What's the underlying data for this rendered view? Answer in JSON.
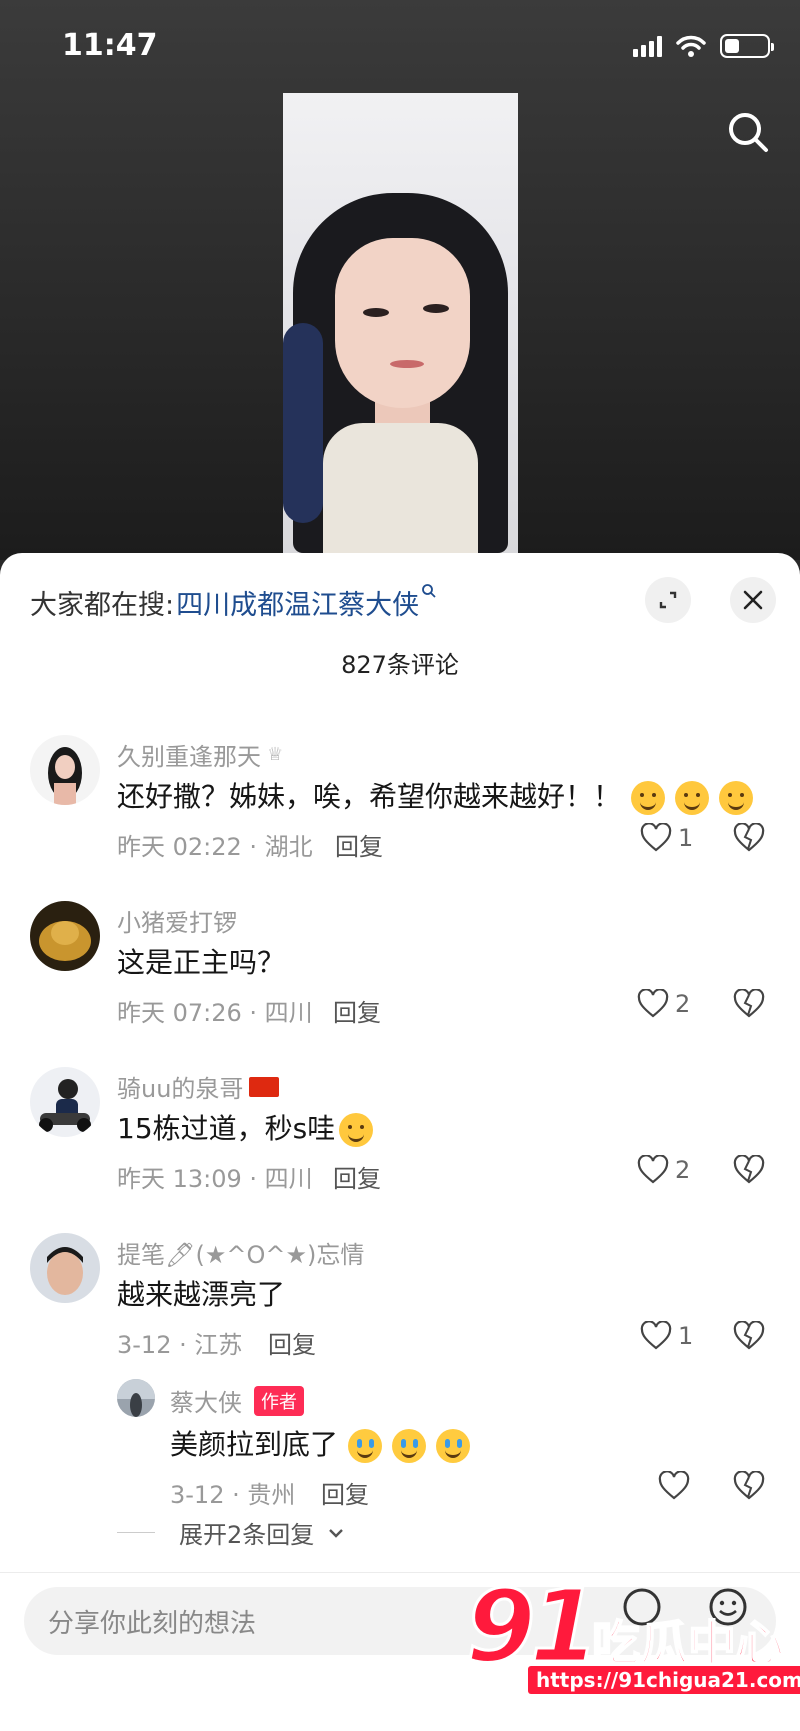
{
  "status_bar": {
    "time": "11:47"
  },
  "sheet": {
    "trend_prefix": "大家都在搜:",
    "trend_link": "四川成都温江蔡大侠",
    "comment_count": "827条评论"
  },
  "comments": [
    {
      "name": "久别重逢那天",
      "name_badge": "♕",
      "text": "还好撒？姊妹，唉，希望你越来越好！！",
      "time_loc": "昨天 02:22 · 湖北",
      "reply": "回复",
      "likes": "1"
    },
    {
      "name": "小猪爱打锣",
      "text": "这是正主吗？",
      "time_loc": "昨天 07:26 · 四川",
      "reply": "回复",
      "likes": "2"
    },
    {
      "name": "骑uu的泉哥",
      "name_badge": "🇨🇳",
      "text": "15栋过道，秒s哇",
      "time_loc": "昨天 13:09 · 四川",
      "reply": "回复",
      "likes": "2"
    },
    {
      "name": "提笔🖊(★^O^★)忘情",
      "text": "越来越漂亮了",
      "time_loc": "3-12 · 江苏",
      "reply": "回复",
      "likes": "1"
    }
  ],
  "sub_reply": {
    "name": "蔡大侠",
    "badge": "作者",
    "text": "美颜拉到底了",
    "time_loc": "3-12 · 贵州",
    "reply": "回复"
  },
  "expand_more": "展开2条回复",
  "input": {
    "placeholder": "分享你此刻的想法"
  },
  "watermark": {
    "big": "91",
    "cn": "吃瓜中心",
    "url": "https://91chigua21.com"
  },
  "colors": {
    "accent": "#fe2c55",
    "link": "#1f4d8f",
    "watermark": "#ff1a3c"
  }
}
